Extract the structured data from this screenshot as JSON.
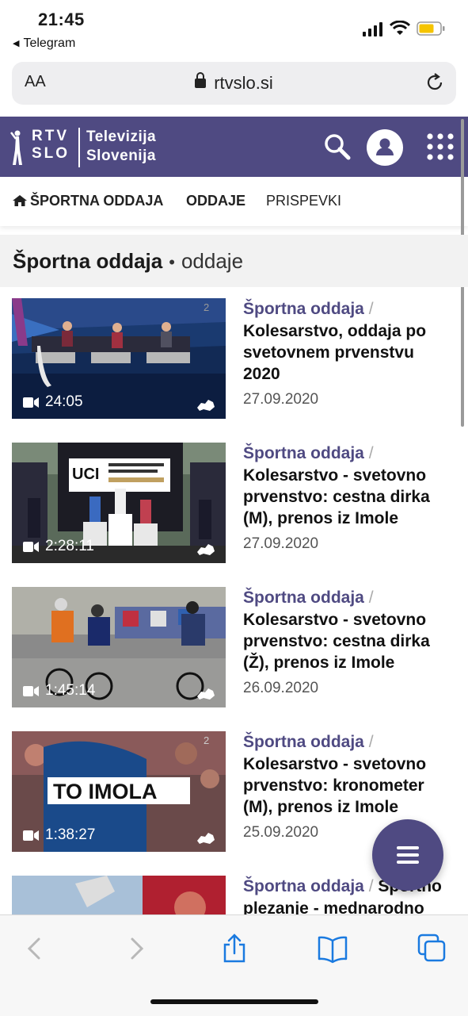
{
  "status": {
    "time": "21:45",
    "back_app": "Telegram"
  },
  "browser": {
    "text_size_label": "AA",
    "domain": "rtvslo.si"
  },
  "site": {
    "logo_rtv_line1": "RTV",
    "logo_rtv_line2": "SLO",
    "logo_tv_line1": "Televizija",
    "logo_tv_line2": "Slovenija",
    "brand_color": "#4f4a82"
  },
  "nav": {
    "items": [
      "ŠPORTNA ODDAJA",
      "ODDAJE",
      "PRISPEVKI"
    ]
  },
  "page": {
    "title": "Športna oddaja",
    "separator": "•",
    "subtitle": "oddaje"
  },
  "videos": [
    {
      "show": "Športna oddaja",
      "slash": "/",
      "title_lines": [
        "Kolesarstvo, oddaja po",
        "svetovnem prvenstvu",
        "2020"
      ],
      "date": "27.09.2020",
      "duration": "24:05"
    },
    {
      "show": "Športna oddaja",
      "slash": "/",
      "title_lines": [
        "Kolesarstvo - svetovno",
        "prvenstvo: cestna dirka",
        "(M), prenos iz Imole"
      ],
      "date": "27.09.2020",
      "duration": "2:28:11",
      "thumb_text": "UCI"
    },
    {
      "show": "Športna oddaja",
      "slash": "/",
      "title_lines": [
        "Kolesarstvo - svetovno",
        "prvenstvo: cestna dirka",
        "(Ž), prenos iz Imole"
      ],
      "date": "26.09.2020",
      "duration": "1:45:14"
    },
    {
      "show": "Športna oddaja",
      "slash": "/",
      "title_lines": [
        "Kolesarstvo - svetovno",
        "prvenstvo: kronometer",
        "(M), prenos iz Imole"
      ],
      "date": "25.09.2020",
      "duration": "1:38:27",
      "thumb_text": "TO IMOLA"
    },
    {
      "show": "Športna oddaja",
      "slash": "/",
      "title_inline": "Športno",
      "title_lines": [
        "plezanje - mednarodno"
      ]
    }
  ],
  "icons": {
    "search": "search-icon",
    "user": "user-icon",
    "grid": "grid-icon",
    "menu": "hamburger-menu-icon",
    "back": "back-arrow-icon",
    "forward": "forward-arrow-icon",
    "share": "share-icon",
    "bookmarks": "bookmarks-icon",
    "tabs": "tabs-icon"
  }
}
